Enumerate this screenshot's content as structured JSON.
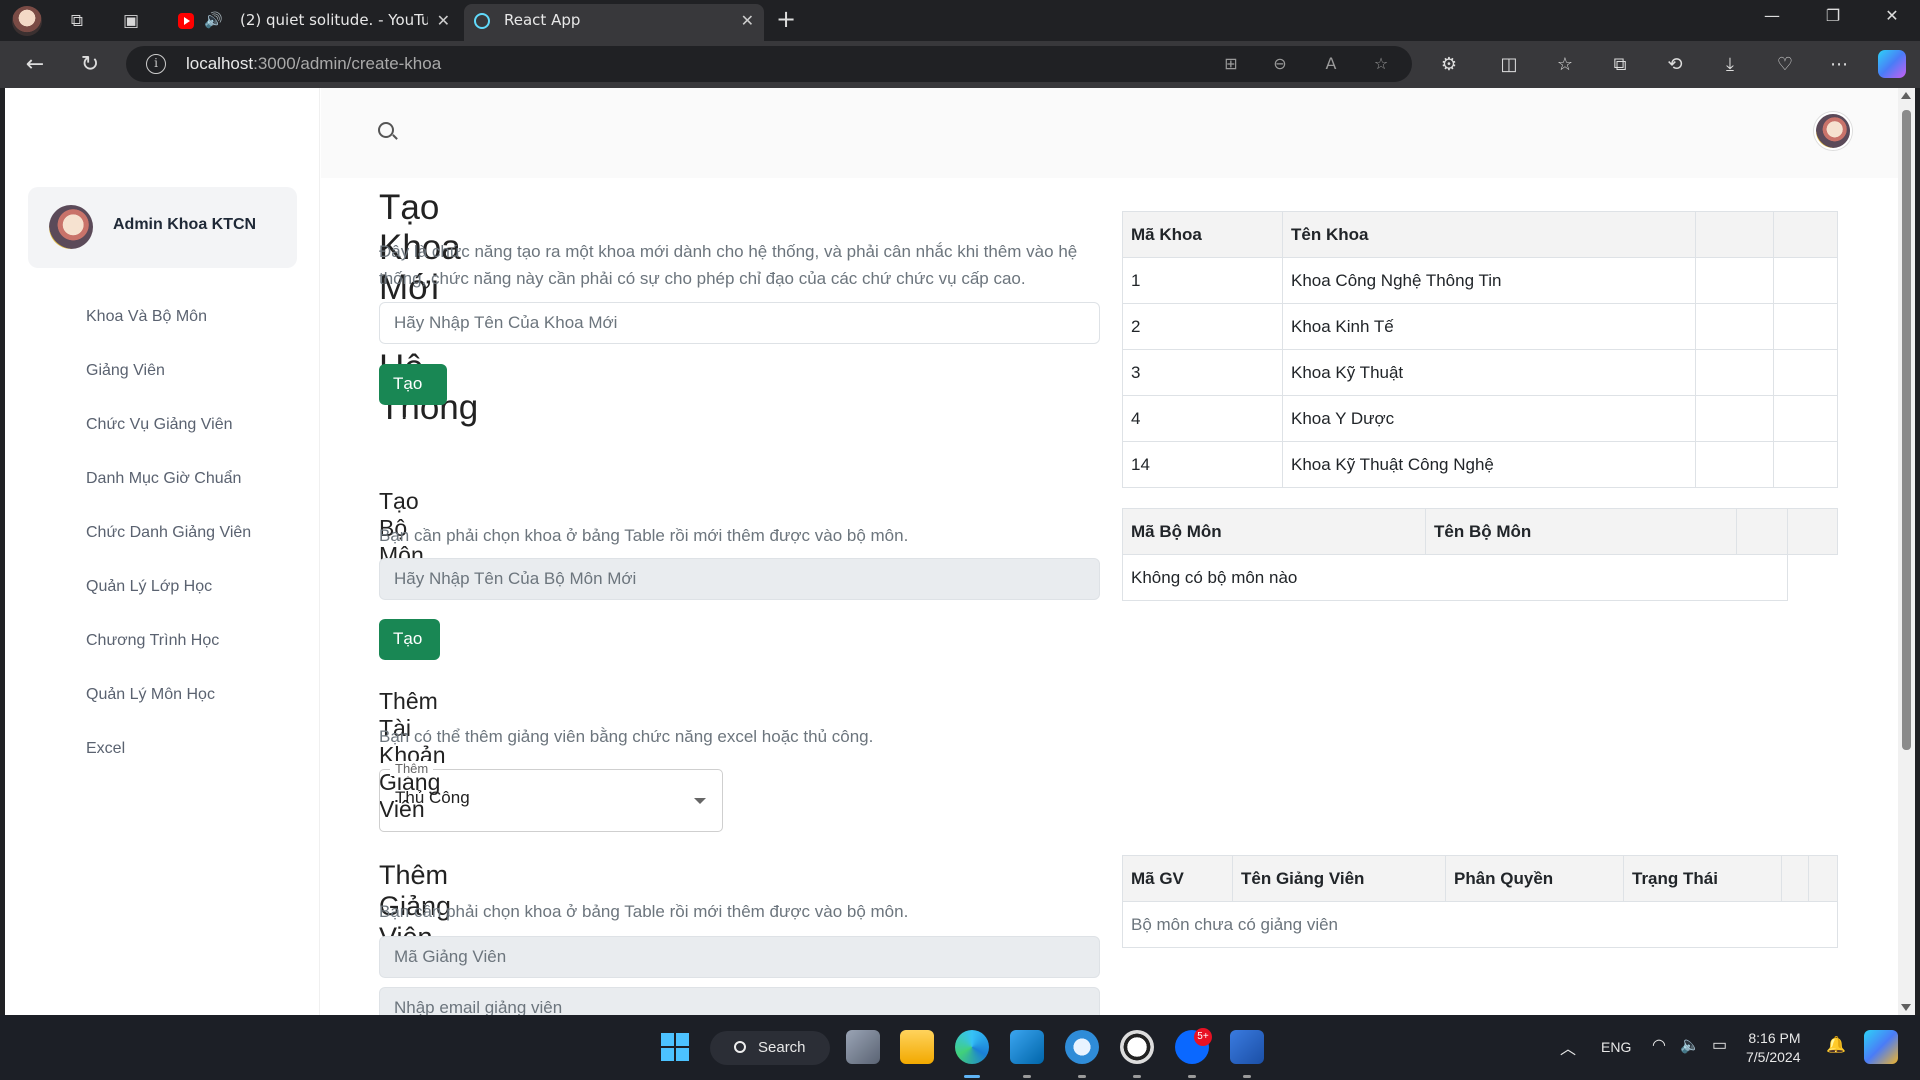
{
  "browser": {
    "tabs": [
      {
        "title": "(2) quiet solitude. - YouTube",
        "active": false
      },
      {
        "title": "React App",
        "active": true
      }
    ],
    "url_host": "localhost",
    "url_path": ":3000/admin/create-khoa"
  },
  "sidebar": {
    "profile_name": "Admin Khoa KTCN",
    "items": [
      {
        "label": "Khoa Và Bộ Môn"
      },
      {
        "label": "Giảng Viên"
      },
      {
        "label": "Chức Vụ Giảng Viên"
      },
      {
        "label": "Danh Mục Giờ Chuẩn"
      },
      {
        "label": "Chức Danh Giảng Viên"
      },
      {
        "label": "Quản Lý Lớp Học"
      },
      {
        "label": "Chương Trình Học"
      },
      {
        "label": "Quản Lý Môn Học"
      },
      {
        "label": "Excel"
      }
    ]
  },
  "create_khoa": {
    "title": "Tạo Khoa Mới Cho Hệ Thống",
    "description": "Đây là chức năng tạo ra một khoa mới dành cho hệ thống, và phải cân nhắc khi thêm vào hệ thống, chức năng này cần phải có sự cho phép chỉ đạo của các chứ chức vụ cấp cao.",
    "placeholder": "Hãy Nhập Tên Của Khoa Mới",
    "button": "Tạo Khoa"
  },
  "create_bomon": {
    "title": "Tạo Bộ Môn",
    "description": "Bạn cần phải chọn khoa ở bảng Table rồi mới thêm được vào bộ môn.",
    "placeholder": "Hãy Nhập Tên Của Bộ Môn Mới",
    "button": "Tạo Bộ Môn"
  },
  "add_account": {
    "title": "Thêm Tài Khoản Giảng Viên",
    "description": "Bạn có thể thêm giảng viên bằng chức năng excel hoặc thủ công.",
    "select_label": "Thêm",
    "select_value": "Thủ Công"
  },
  "add_gv": {
    "title": "Thêm Giảng Viên",
    "description": "Bạn cần phải chọn khoa ở bảng Table rồi mới thêm được vào bộ môn.",
    "placeholder_ma": "Mã Giảng Viên",
    "placeholder_email": "Nhập email giảng viên"
  },
  "table_khoa": {
    "headers": [
      "Mã Khoa",
      "Tên Khoa"
    ],
    "rows": [
      {
        "ma": "1",
        "ten": "Khoa Công Nghệ Thông Tin"
      },
      {
        "ma": "2",
        "ten": "Khoa Kinh Tế"
      },
      {
        "ma": "3",
        "ten": "Khoa Kỹ Thuật"
      },
      {
        "ma": "4",
        "ten": "Khoa Y Dược"
      },
      {
        "ma": "14",
        "ten": "Khoa Kỹ Thuật Công Nghệ"
      }
    ]
  },
  "table_bomon": {
    "headers": [
      "Mã Bộ Môn",
      "Tên Bộ Môn"
    ],
    "empty": "Không có bộ môn nào"
  },
  "table_gv": {
    "headers": [
      "Mã GV",
      "Tên Giảng Viên",
      "Phân Quyền",
      "Trạng Thái"
    ],
    "empty": "Bộ môn chưa có giảng viên"
  },
  "taskbar": {
    "search": "Search",
    "language": "ENG",
    "time": "8:16 PM",
    "date": "7/5/2024",
    "zalo_badge": "5+"
  }
}
